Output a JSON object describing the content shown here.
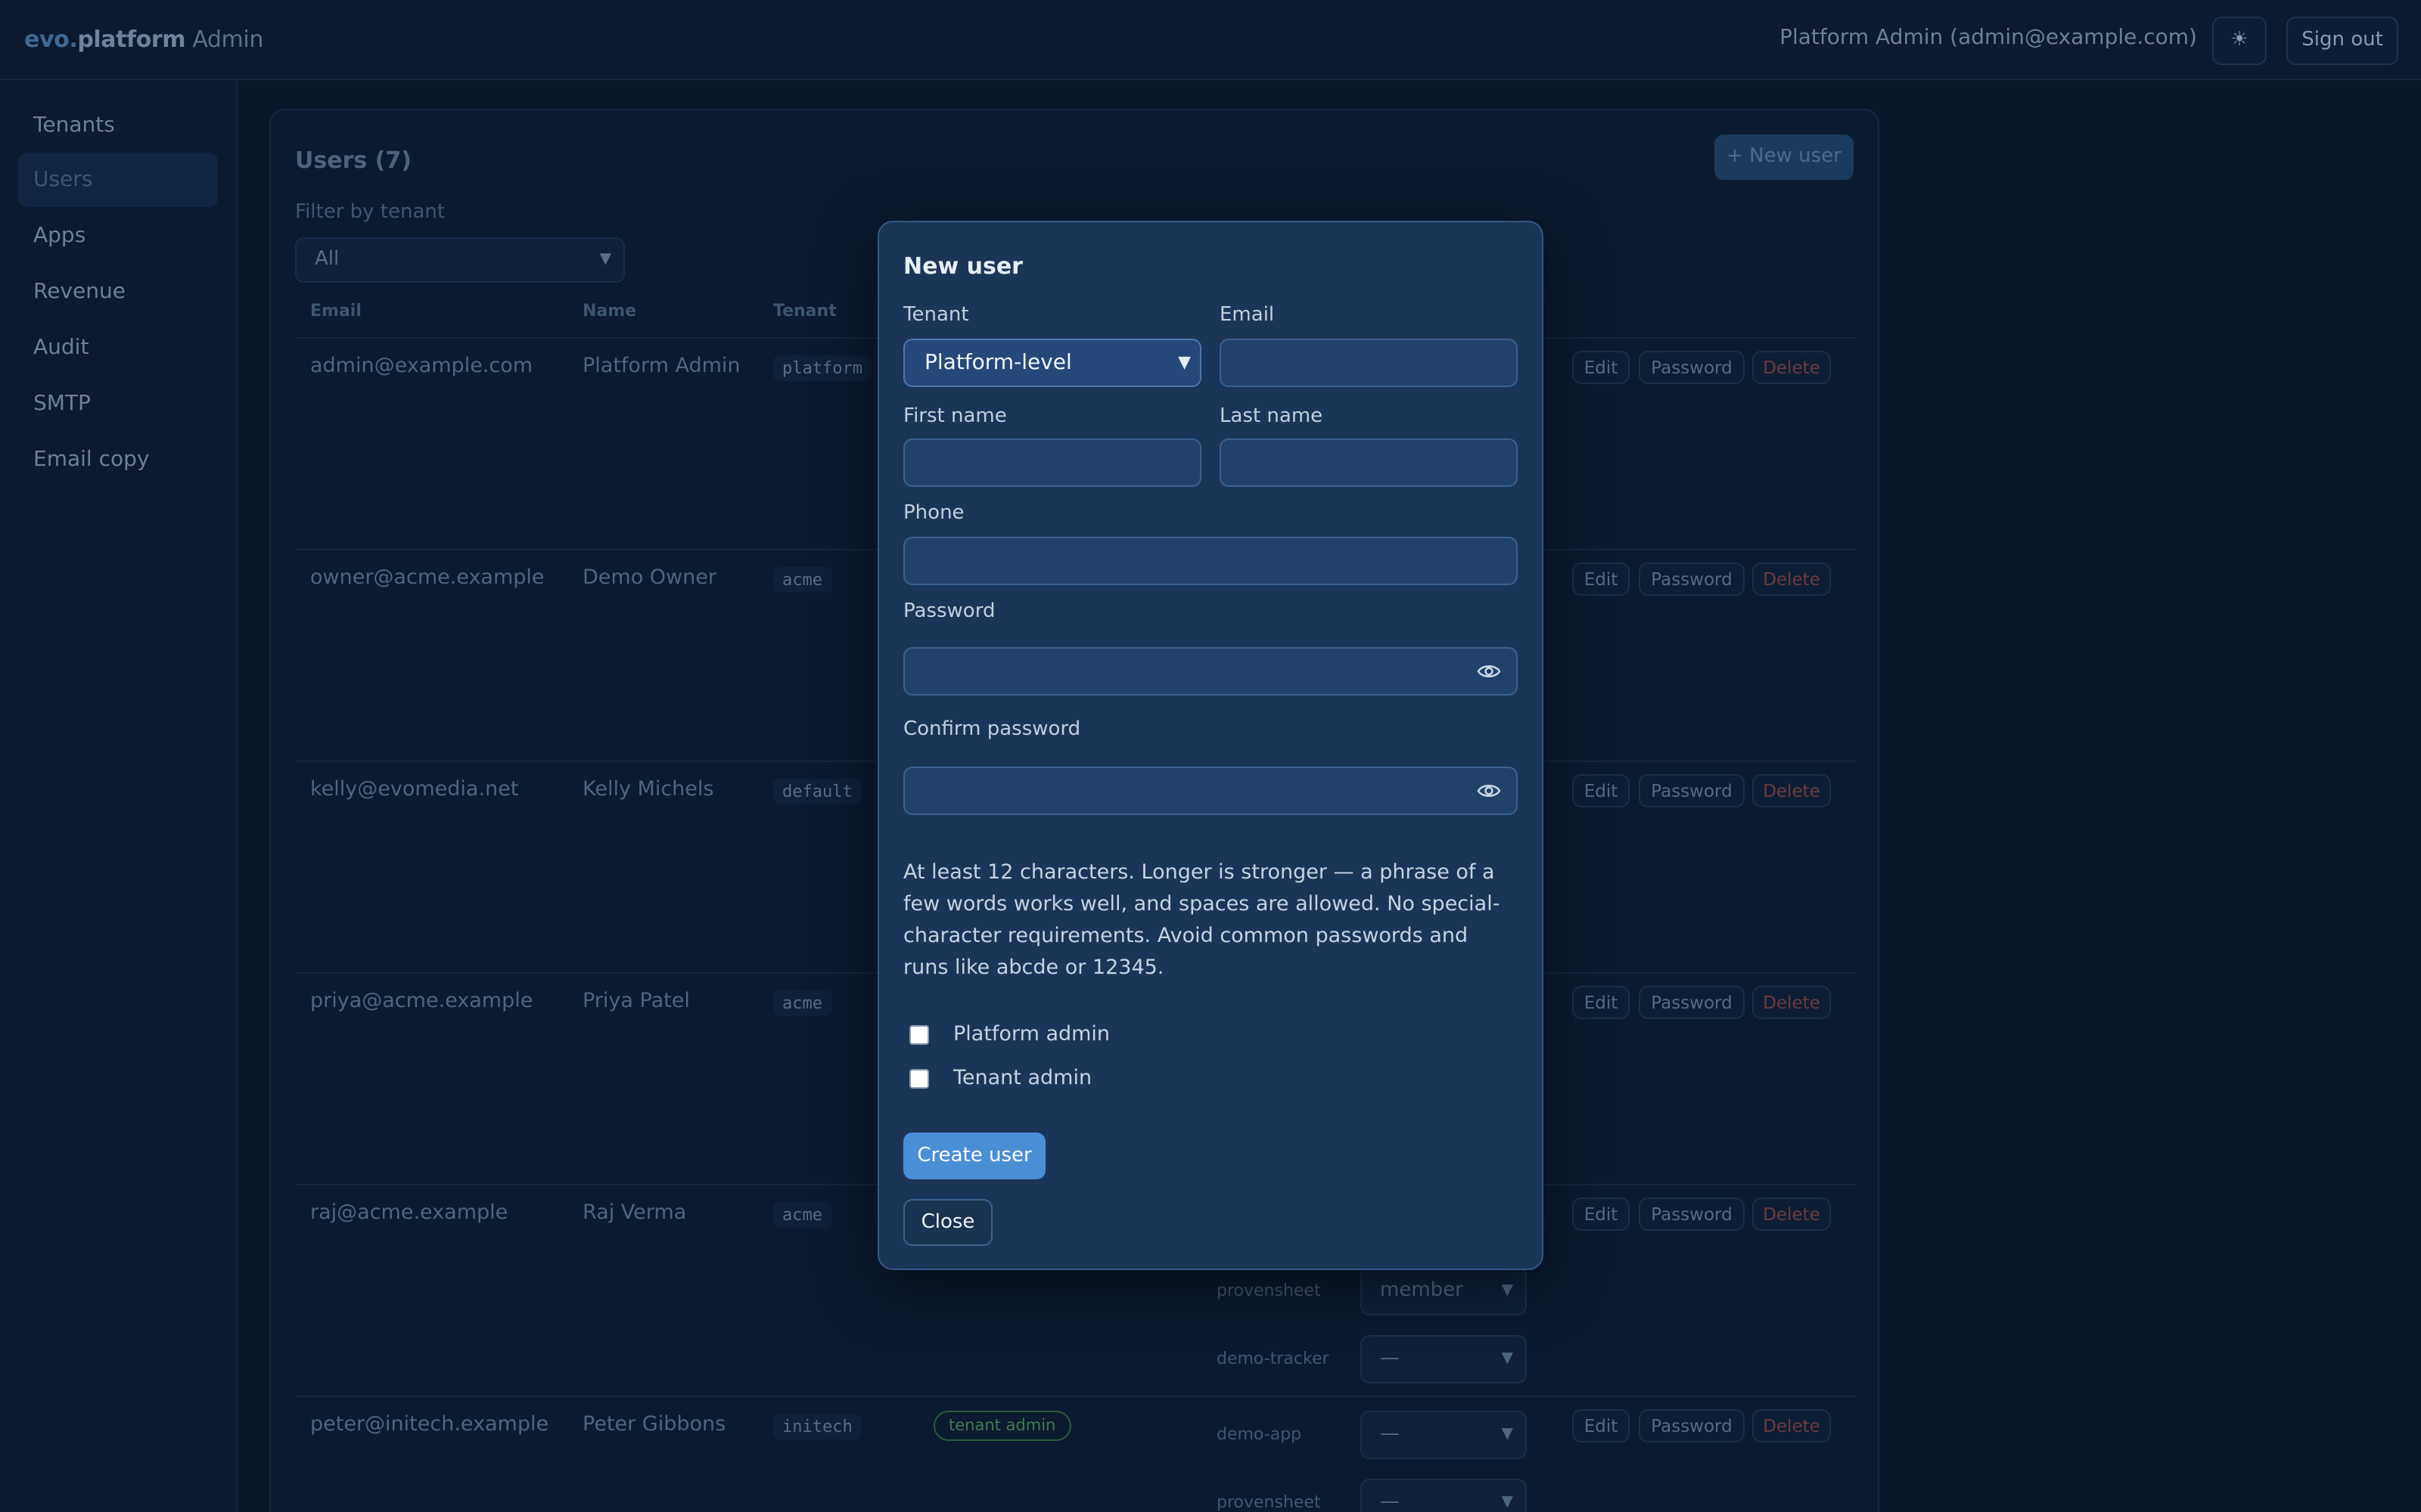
{
  "topbar": {
    "brand_part1": "evo.",
    "brand_part2": "platform",
    "brand_part3": " Admin",
    "user_info": "Platform Admin (admin@example.com)",
    "theme_icon": "☀",
    "sign_out": "Sign out"
  },
  "sidebar": {
    "items": [
      {
        "label": "Tenants"
      },
      {
        "label": "Users"
      },
      {
        "label": "Apps"
      },
      {
        "label": "Revenue"
      },
      {
        "label": "Audit"
      },
      {
        "label": "SMTP"
      },
      {
        "label": "Email copy"
      }
    ],
    "active_index": 1
  },
  "users": {
    "title": "Users (7)",
    "new_user_button": "+ New user",
    "filter_label": "Filter by tenant",
    "filter_value": "All",
    "columns": [
      "Email",
      "Name",
      "Tenant"
    ],
    "rows": [
      {
        "email": "admin@example.com",
        "name": "Platform Admin",
        "tenant": "platform"
      },
      {
        "email": "owner@acme.example",
        "name": "Demo Owner",
        "tenant": "acme"
      },
      {
        "email": "kelly@evomedia.net",
        "name": "Kelly Michels",
        "tenant": "default"
      },
      {
        "email": "priya@acme.example",
        "name": "Priya Patel",
        "tenant": "acme"
      },
      {
        "email": "raj@acme.example",
        "name": "Raj Verma",
        "tenant": "acme"
      },
      {
        "email": "peter@initech.example",
        "name": "Peter Gibbons",
        "tenant": "initech"
      }
    ],
    "actions": {
      "edit": "Edit",
      "password": "Password",
      "delete": "Delete"
    },
    "raj_apps": [
      {
        "app": "provensheet",
        "role": "member"
      },
      {
        "app": "demo-tracker",
        "role": "—"
      }
    ],
    "peter_badge": "tenant admin",
    "peter_apps": [
      {
        "app": "demo-app",
        "role": "—"
      },
      {
        "app": "provensheet",
        "role": "—"
      }
    ]
  },
  "modal": {
    "title": "New user",
    "tenant_label": "Tenant",
    "tenant_value": "Platform-level",
    "email_label": "Email",
    "first_name_label": "First name",
    "last_name_label": "Last name",
    "phone_label": "Phone",
    "password_label": "Password",
    "confirm_label": "Confirm password",
    "hint": "At least 12 characters. Longer is stronger — a phrase of a few words works well, and spaces are allowed. No special-character requirements. Avoid common passwords and runs like abcde or 12345.",
    "platform_admin_label": "Platform admin",
    "tenant_admin_label": "Tenant admin",
    "create_button": "Create user",
    "close_button": "Close"
  }
}
